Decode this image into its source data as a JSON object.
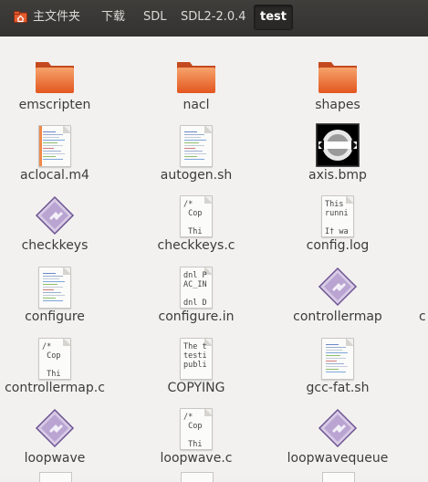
{
  "breadcrumb": {
    "items": [
      "主文件夹",
      "下载",
      "SDL",
      "SDL2-2.0.4",
      "test"
    ],
    "active_index": 4
  },
  "files": [
    {
      "name": "emscripten",
      "icon": "folder-icon"
    },
    {
      "name": "nacl",
      "icon": "folder-icon"
    },
    {
      "name": "shapes",
      "icon": "folder-icon"
    },
    {
      "name": "aclocal.m4",
      "icon": "text-document-icon"
    },
    {
      "name": "autogen.sh",
      "icon": "script-document-icon"
    },
    {
      "name": "axis.bmp",
      "icon": "image-thumbnail-icon"
    },
    {
      "name": "checkkeys",
      "icon": "executable-icon"
    },
    {
      "name": "checkkeys.c",
      "icon": "c-source-icon",
      "preview": "/*\n Cop\n\n Thi"
    },
    {
      "name": "config.log",
      "icon": "text-preview-icon",
      "preview": "This\nrunni\n\nI† wa"
    },
    {
      "name": "configure",
      "icon": "script-document-icon"
    },
    {
      "name": "configure.in",
      "icon": "text-preview-icon",
      "preview": "dnl P\nAC_IN\n\ndnl D"
    },
    {
      "name": "controllermap",
      "icon": "executable-icon"
    },
    {
      "name": "controllermap.c",
      "icon": "c-source-icon",
      "preview": "/*\n Cop\n\n Thi"
    },
    {
      "name": "COPYING",
      "icon": "text-preview-icon",
      "preview": "The t\ntesti\npubli"
    },
    {
      "name": "gcc-fat.sh",
      "icon": "script-document-icon"
    },
    {
      "name": "loopwave",
      "icon": "executable-icon"
    },
    {
      "name": "loopwave.c",
      "icon": "c-source-icon",
      "preview": "/*\n Cop\n\n Thi"
    },
    {
      "name": "loopwavequeue",
      "icon": "executable-icon"
    }
  ],
  "partial_column_label": "c"
}
